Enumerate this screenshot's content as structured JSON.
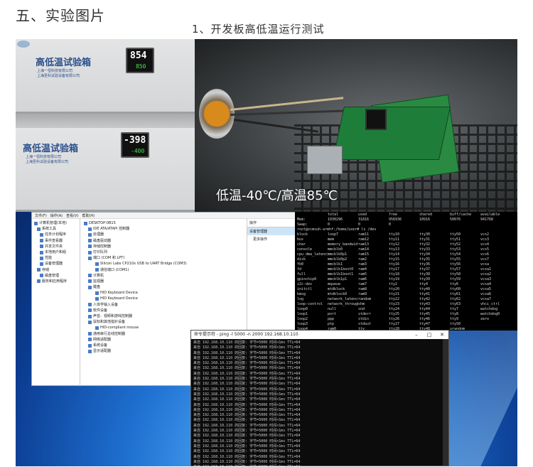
{
  "heading": "五、实验图片",
  "subheading": "1、开发板高低温运行测试",
  "photo_chambers": {
    "chamber_top": {
      "title": "高低温试验箱",
      "line1": "上海一恒科技有限公司",
      "line2": "上海圣科试验设备有限公司",
      "pv": "854",
      "sv": "850"
    },
    "chamber_bottom": {
      "title": "高低温试验箱",
      "line1": "上海一恒科技有限公司",
      "line2": "上海圣科试验设备有限公司",
      "pv": "-398",
      "sv": "-400"
    }
  },
  "photo_board": {
    "caption": "低温-40℃/高温85℃"
  },
  "device_manager": {
    "menu": [
      "文件(F)",
      "操作(A)",
      "查看(V)",
      "帮助(H)"
    ],
    "left_tree": [
      "计算机管理(本地)",
      "系统工具",
      "任务计划程序",
      "事件查看器",
      "共享文件夹",
      "本地用户和组",
      "性能",
      "设备管理器",
      "存储",
      "磁盘管理",
      "服务和应用程序"
    ],
    "main_tree": [
      "DESKTOP-0B15",
      "IDE ATA/ATAPI 控制器",
      "处理器",
      "磁盘驱动器",
      "存储控制器",
      "打印队列",
      "端口 (COM 和 LPT)",
      "Silicon Labs CP210x USB to UART Bridge (COM3)",
      "通信端口 (COM1)",
      "计算机",
      "监视器",
      "键盘",
      "HID Keyboard Device",
      "HID Keyboard Device",
      "人体学输入设备",
      "软件设备",
      "声音、视频和游戏控制器",
      "鼠标和其他指针设备",
      "HID-compliant mouse",
      "通用串行总线控制器",
      "网络适配器",
      "系统设备",
      "显示适配器"
    ],
    "actions_head": "操作",
    "actions_selected": "设备管理器",
    "actions_more": "更多操作"
  },
  "terminal": {
    "header": [
      "",
      "total",
      "used",
      "free",
      "shared",
      "buff/cache",
      "available"
    ],
    "mem": [
      "Mem:",
      "1030296",
      "31816",
      "956936",
      "10916",
      "50076",
      "941768"
    ],
    "swap": [
      "Swap:",
      "0",
      "0",
      "0",
      "",
      "",
      ""
    ],
    "prompt": "root@zcmsuh-armhf:/home/user# ls /dev",
    "rows": [
      [
        "block",
        "loop7",
        "ram11",
        "tty10",
        "tty30",
        "tty50",
        "vcs2"
      ],
      [
        "bus",
        "mem",
        "ram12",
        "tty11",
        "tty31",
        "tty51",
        "vcs3"
      ],
      [
        "char",
        "memory_bandwidth",
        "ram13",
        "tty12",
        "tty32",
        "tty52",
        "vcs4"
      ],
      [
        "console",
        "mmcblk0",
        "ram14",
        "tty13",
        "tty33",
        "tty53",
        "vcs5"
      ],
      [
        "cpu_dma_latency",
        "mmcblk0p1",
        "ram15",
        "tty14",
        "tty34",
        "tty54",
        "vcs6"
      ],
      [
        "disk",
        "mmcblk0p2",
        "ram2",
        "tty15",
        "tty35",
        "tty55",
        "vcs7"
      ],
      [
        "fb0",
        "mmcblk1",
        "ram3",
        "tty16",
        "tty36",
        "tty56",
        "vcsa"
      ],
      [
        "fd",
        "mmcblk1boot0",
        "ram4",
        "tty17",
        "tty37",
        "tty57",
        "vcsa1"
      ],
      [
        "full",
        "mmcblk1boot1",
        "ram5",
        "tty18",
        "tty38",
        "tty58",
        "vcsa2"
      ],
      [
        "gpiochip0",
        "mmcblk1p1",
        "ram6",
        "tty19",
        "tty39",
        "tty59",
        "vcsa3"
      ],
      [
        "i2c-dev",
        "mqueue",
        "ram7",
        "tty2",
        "tty4",
        "tty6",
        "vcsa4"
      ],
      [
        "initctl",
        "mtdblock",
        "ram8",
        "tty20",
        "tty40",
        "tty60",
        "vcsa5"
      ],
      [
        "kmsg",
        "mtdblock0",
        "ram9",
        "tty21",
        "tty41",
        "tty61",
        "vcsa6"
      ],
      [
        "log",
        "network_latency",
        "random",
        "tty22",
        "tty42",
        "tty62",
        "vcsa7"
      ],
      [
        "loop-control",
        "network_throughput",
        "shm",
        "tty23",
        "tty43",
        "tty63",
        "vhci_ctrl"
      ],
      [
        "loop0",
        "null",
        "snd",
        "tty24",
        "tty44",
        "tty7",
        "watchdog"
      ],
      [
        "loop1",
        "port",
        "stderr",
        "tty25",
        "tty45",
        "tty8",
        "watchdog0"
      ],
      [
        "loop2",
        "ppp",
        "stdin",
        "tty26",
        "tty46",
        "tty9",
        "zero"
      ],
      [
        "loop3",
        "ptp",
        "stdout",
        "tty27",
        "tty47",
        "ttyS0",
        ""
      ],
      [
        "loop4",
        "ram0",
        "tty",
        "tty28",
        "tty48",
        "urandom",
        ""
      ],
      [
        "loop5",
        "ram1",
        "tty0",
        "tty29",
        "tty49",
        "vcs",
        ""
      ],
      [
        "loop6",
        "ram10",
        "tty1",
        "tty3",
        "tty5",
        "vcs1",
        ""
      ]
    ],
    "last": "root@zcmsuh-armhf:/home/user# random: crng init done"
  },
  "cmd": {
    "title": "命令提示符 - ping -l 5000 -n 2000 192.168.10.110",
    "line": "来自 192.168.10.110 的回复: 字节=5000 时间<1ms TTL=64",
    "count": 25
  }
}
